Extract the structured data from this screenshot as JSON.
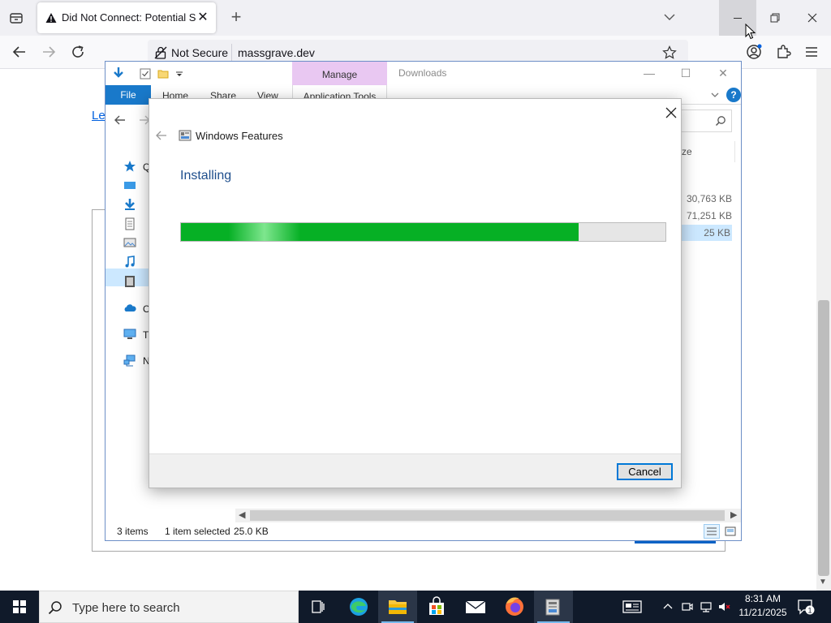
{
  "browser": {
    "tab_title": "Did Not Connect: Potential Security Issue",
    "not_secure_label": "Not Secure",
    "url": "massgrave.dev",
    "page_link_text": "Le"
  },
  "explorer": {
    "window_title": "Downloads",
    "manage_tab": "Manage",
    "ribbon": {
      "file": "File",
      "home": "Home",
      "share": "Share",
      "view": "View",
      "app_tools": "Application Tools"
    },
    "column_size_header": "ze",
    "file_sizes": [
      "30,763 KB",
      "71,251 KB",
      "25 KB"
    ],
    "nav_items": [
      "Q",
      "O",
      "Th",
      "N"
    ],
    "status": {
      "items": "3 items",
      "selected": "1 item selected",
      "size": "25.0 KB"
    }
  },
  "dialog": {
    "title": "Windows Features",
    "heading": "Installing",
    "progress": 0.82,
    "cancel_label": "Cancel"
  },
  "taskbar": {
    "search_placeholder": "Type here to search",
    "time": "8:31 AM",
    "date": "11/21/2025",
    "notification_count": "1"
  },
  "colors": {
    "progress_green": "#06b025",
    "accent_blue": "#0078d7",
    "manage_tab_bg": "#e9c8f2",
    "taskbar_bg": "#101a2a"
  }
}
